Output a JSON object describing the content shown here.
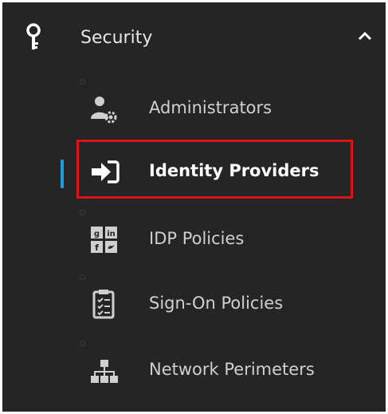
{
  "section": {
    "label": "Security",
    "icon": "key-icon",
    "state_icon": "chevron-up-icon",
    "expanded": true
  },
  "items": [
    {
      "label": "Administrators",
      "icon": "admin-gear-icon",
      "active": false
    },
    {
      "label": "Identity Providers",
      "icon": "sign-in-icon",
      "active": true
    },
    {
      "label": "IDP Policies",
      "icon": "social-logins-icon",
      "active": false
    },
    {
      "label": "Sign-On Policies",
      "icon": "checklist-icon",
      "active": false
    },
    {
      "label": "Network Perimeters",
      "icon": "network-icon",
      "active": false
    }
  ],
  "colors": {
    "background": "#252525",
    "text": "#d0d0d0",
    "active_text": "#ffffff",
    "active_indicator": "#1f9bde",
    "highlight": "#d9141b"
  }
}
